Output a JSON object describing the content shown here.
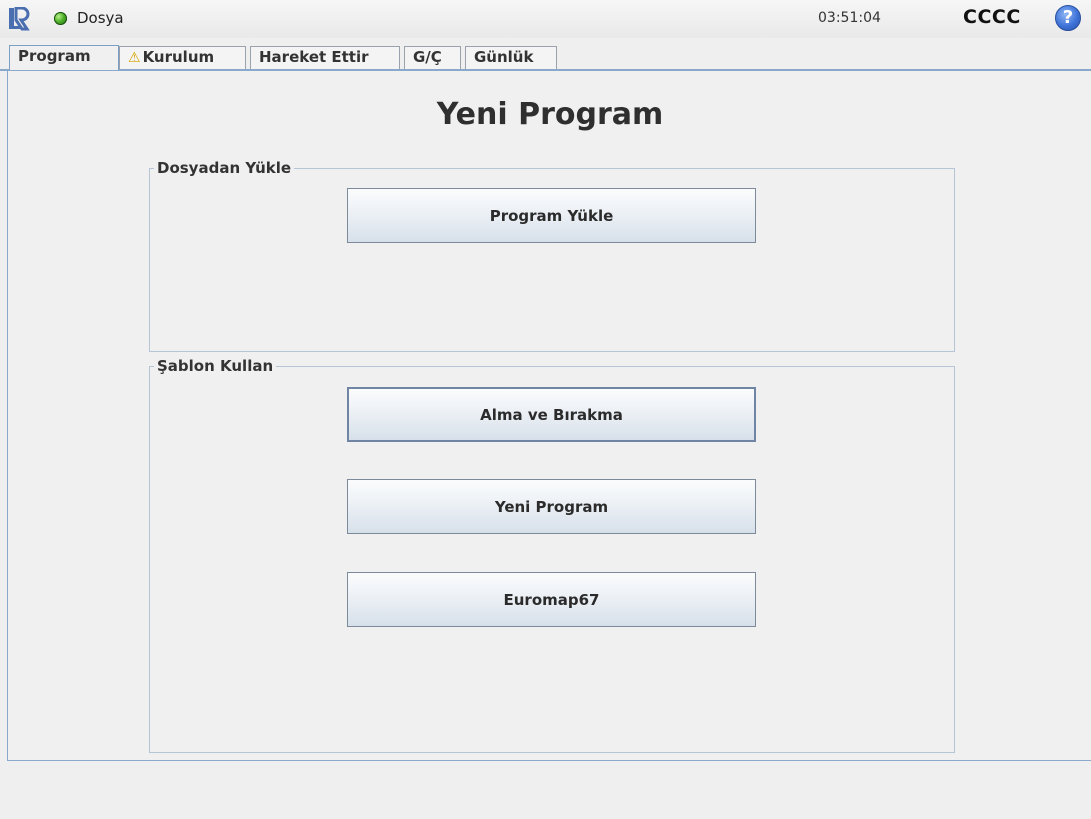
{
  "topbar": {
    "file_menu": "Dosya",
    "clock": "03:51:04",
    "robot_name": "CCCC",
    "help_symbol": "?",
    "logo_icon": "ur-logo-icon",
    "status_icon": "status-green-icon"
  },
  "tabs": [
    {
      "label": "Program",
      "active": true
    },
    {
      "label": "Kurulum",
      "warning": true,
      "warning_icon": "⚠"
    },
    {
      "label": "Hareket Ettir"
    },
    {
      "label": "G/Ç"
    },
    {
      "label": "Günlük"
    }
  ],
  "main": {
    "title": "Yeni Program",
    "load_group": {
      "label": "Dosyadan Yükle",
      "button": "Program Yükle"
    },
    "template_group": {
      "label": "Şablon Kullan",
      "buttons": [
        "Alma ve Bırakma",
        "Yeni Program",
        "Euromap67"
      ]
    }
  },
  "colors": {
    "accent_border": "#8aa8cc",
    "status_green": "#4cae27",
    "help_blue": "#3f73d8",
    "warning_yellow": "#d7a400"
  }
}
